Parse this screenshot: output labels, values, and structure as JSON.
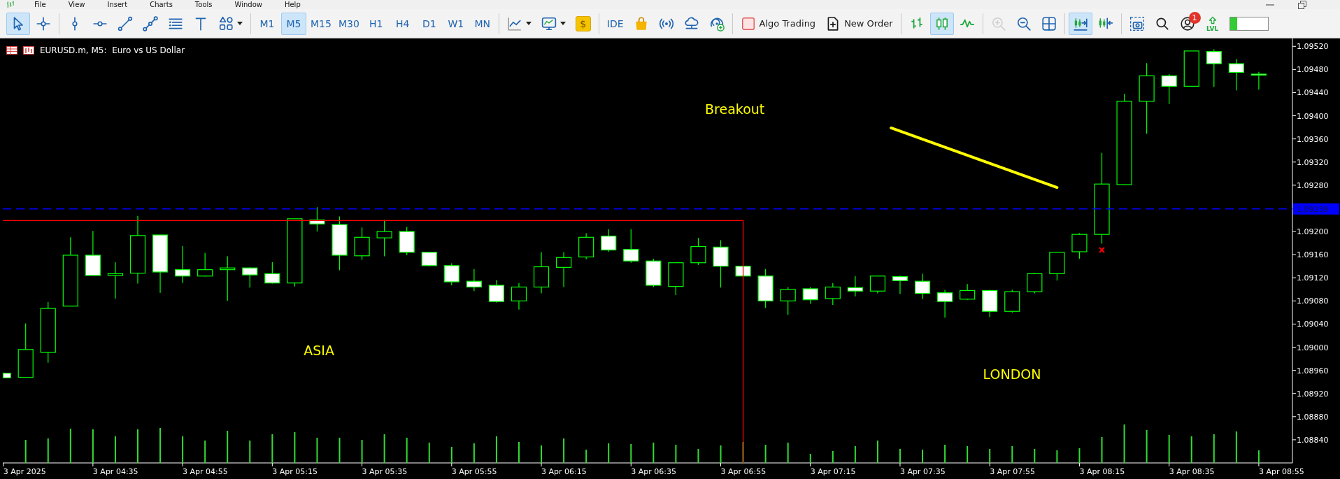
{
  "menu": [
    "File",
    "View",
    "Insert",
    "Charts",
    "Tools",
    "Window",
    "Help"
  ],
  "toolbar": {
    "groups": [
      [
        {
          "kind": "cursor",
          "selected": true,
          "disabled": false
        },
        {
          "kind": "crosshair",
          "selected": false,
          "disabled": false
        }
      ],
      [
        {
          "kind": "vertical_line",
          "selected": false,
          "disabled": false
        },
        {
          "kind": "horizontal_line",
          "selected": false,
          "disabled": false
        },
        {
          "kind": "trend_line",
          "selected": false,
          "disabled": false
        },
        {
          "kind": "channel",
          "selected": false,
          "disabled": false
        },
        {
          "kind": "levels",
          "selected": false,
          "disabled": false
        },
        {
          "kind": "text_tool",
          "selected": false,
          "disabled": false
        },
        {
          "kind": "shapes",
          "selected": false,
          "disabled": false
        }
      ],
      [
        {
          "kind": "timeframe",
          "label": "M1",
          "selected": false,
          "disabled": false
        },
        {
          "kind": "timeframe",
          "label": "M5",
          "selected": true,
          "disabled": false
        },
        {
          "kind": "timeframe",
          "label": "M15",
          "selected": false,
          "disabled": false
        },
        {
          "kind": "timeframe",
          "label": "M30",
          "selected": false,
          "disabled": false
        },
        {
          "kind": "timeframe",
          "label": "H1",
          "selected": false,
          "disabled": false
        },
        {
          "kind": "timeframe",
          "label": "H4",
          "selected": false,
          "disabled": false
        },
        {
          "kind": "timeframe",
          "label": "D1",
          "selected": false,
          "disabled": false
        },
        {
          "kind": "timeframe",
          "label": "W1",
          "selected": false,
          "disabled": false
        },
        {
          "kind": "timeframe",
          "label": "MN",
          "selected": false,
          "disabled": false
        }
      ],
      [
        {
          "kind": "chart_type",
          "selected": false,
          "disabled": false
        },
        {
          "kind": "indicators",
          "selected": false,
          "disabled": false
        },
        {
          "kind": "coin",
          "label": "$",
          "selected": false,
          "disabled": false
        }
      ],
      [
        {
          "kind": "text_button",
          "label": "IDE",
          "selected": false,
          "disabled": false
        },
        {
          "kind": "market",
          "selected": false,
          "disabled": false
        },
        {
          "kind": "signals",
          "selected": false,
          "disabled": false
        },
        {
          "kind": "vps",
          "selected": false,
          "disabled": false
        },
        {
          "kind": "subscribe",
          "selected": false,
          "disabled": false
        }
      ],
      [
        {
          "kind": "algo",
          "label": "Algo Trading",
          "on": false,
          "selected": false,
          "disabled": false
        },
        {
          "kind": "new_order",
          "label": "New Order",
          "selected": false,
          "disabled": false
        }
      ],
      [
        {
          "kind": "bars",
          "selected": false,
          "disabled": false
        },
        {
          "kind": "candles",
          "selected": true,
          "disabled": false
        },
        {
          "kind": "line",
          "selected": false,
          "disabled": false
        }
      ],
      [
        {
          "kind": "zoom_in",
          "selected": false,
          "disabled": true
        },
        {
          "kind": "zoom_out",
          "selected": false,
          "disabled": false
        },
        {
          "kind": "tile",
          "selected": false,
          "disabled": false
        }
      ],
      [
        {
          "kind": "autoscroll",
          "selected": true,
          "disabled": false
        },
        {
          "kind": "shift",
          "selected": false,
          "disabled": false
        }
      ],
      [
        {
          "kind": "screenshot",
          "selected": false,
          "disabled": false
        },
        {
          "kind": "search",
          "selected": false,
          "disabled": false
        },
        {
          "kind": "account",
          "badge": "1",
          "selected": false,
          "disabled": false
        },
        {
          "kind": "lvl",
          "label": "LVL",
          "selected": false,
          "disabled": false
        },
        {
          "kind": "meter",
          "level": 0.2
        }
      ]
    ]
  },
  "chart_window": {
    "title": "EURUSD.m, M5:  Euro vs US Dollar",
    "price_axis": {
      "labels": [
        "1.09520",
        "1.09480",
        "1.09440",
        "1.09400",
        "1.09360",
        "1.09320",
        "1.09280",
        "1.09200",
        "1.09160",
        "1.09120",
        "1.09080",
        "1.09040",
        "1.09000",
        "1.08960",
        "1.08920",
        "1.08880",
        "1.08840"
      ]
    },
    "bid_price": "1.09239",
    "time_axis": {
      "labels": [
        "3 Apr 2025",
        "3 Apr 04:35",
        "3 Apr 04:55",
        "3 Apr 05:15",
        "3 Apr 05:35",
        "3 Apr 05:55",
        "3 Apr 06:15",
        "3 Apr 06:35",
        "3 Apr 06:55",
        "3 Apr 07:15",
        "3 Apr 07:35",
        "3 Apr 07:55",
        "3 Apr 08:15",
        "3 Apr 08:35",
        "3 Apr 08:55"
      ]
    },
    "annotations": [
      {
        "kind": "label",
        "text": "Breakout"
      },
      {
        "kind": "label",
        "text": "ASIA"
      },
      {
        "kind": "label",
        "text": "LONDON"
      }
    ]
  }
}
